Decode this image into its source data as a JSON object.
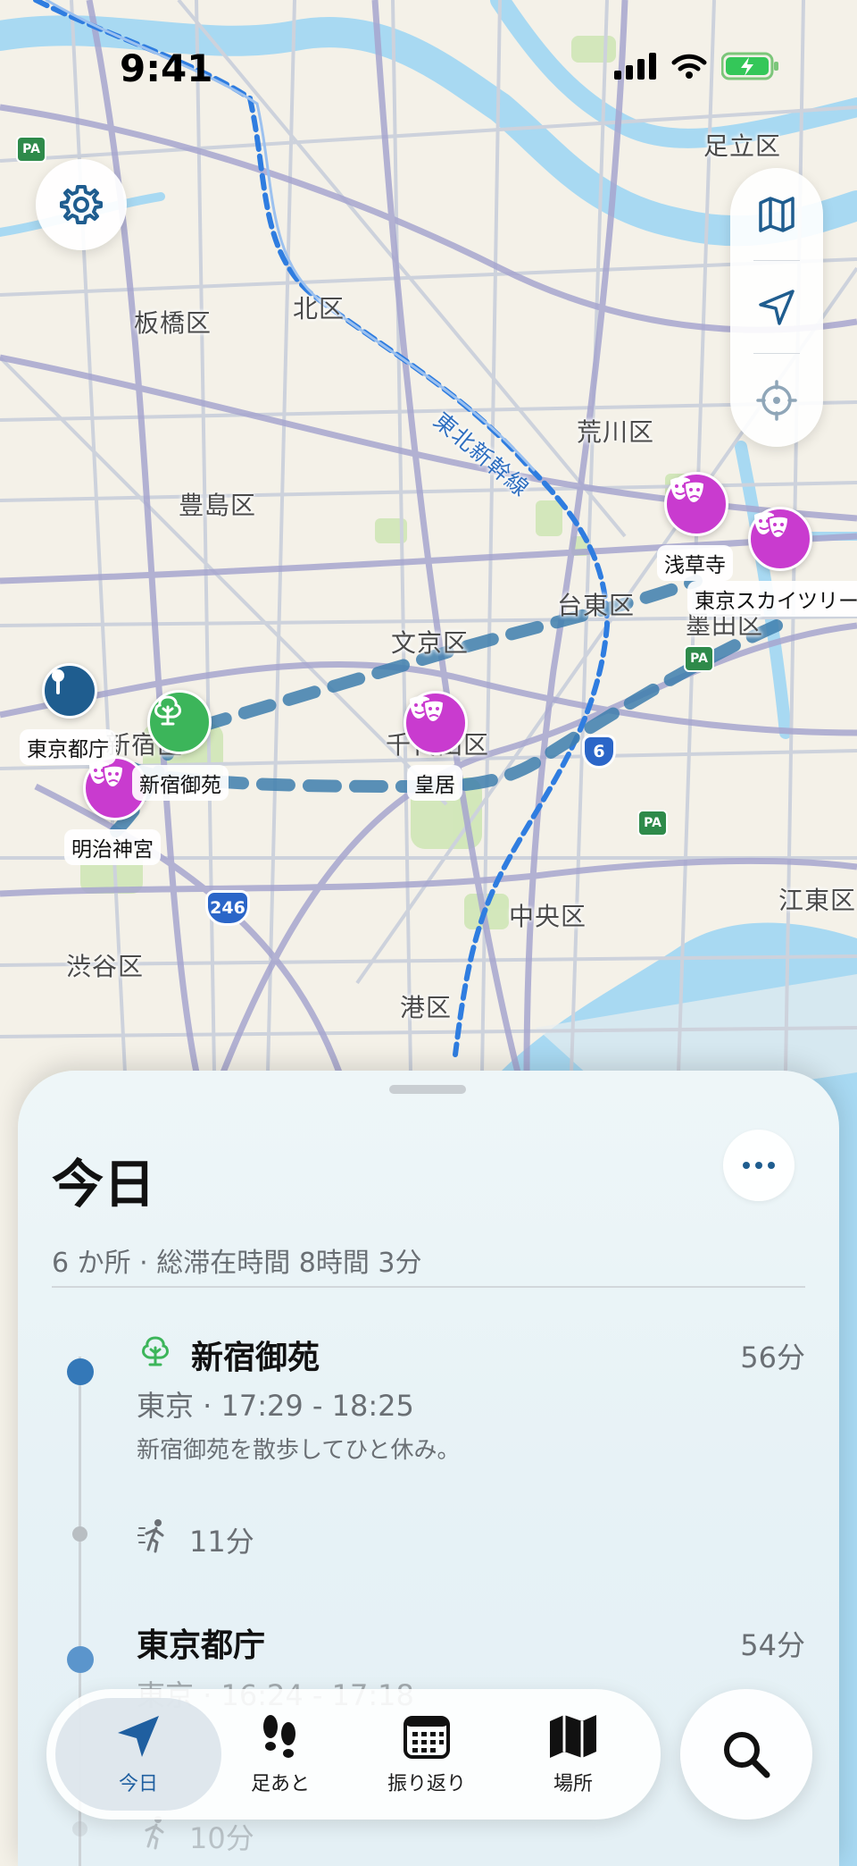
{
  "status_bar": {
    "time": "9:41"
  },
  "map": {
    "districts": [
      {
        "id": "adachi",
        "label": "足立区"
      },
      {
        "id": "itabashi",
        "label": "板橋区"
      },
      {
        "id": "kita",
        "label": "北区"
      },
      {
        "id": "arakawa",
        "label": "荒川区"
      },
      {
        "id": "toshima",
        "label": "豊島区"
      },
      {
        "id": "taito",
        "label": "台東区"
      },
      {
        "id": "bunkyo",
        "label": "文京区"
      },
      {
        "id": "sumida",
        "label": "墨田区"
      },
      {
        "id": "chiyoda",
        "label": "千代田区"
      },
      {
        "id": "shinjuku",
        "label": "新宿区"
      },
      {
        "id": "chuo",
        "label": "中央区"
      },
      {
        "id": "koto",
        "label": "江東区"
      },
      {
        "id": "shibuya",
        "label": "渋谷区"
      },
      {
        "id": "minato",
        "label": "港区"
      },
      {
        "id": "shinkansen",
        "label": "東北新幹線"
      }
    ],
    "route_shields": [
      "246",
      "6"
    ],
    "parking_label": "PA",
    "pins": [
      {
        "id": "sensoji",
        "label": "浅草寺",
        "type": "theatre-icon"
      },
      {
        "id": "skytree",
        "label": "東京スカイツリー",
        "type": "theatre-icon"
      },
      {
        "id": "kokyo",
        "label": "皇居",
        "type": "theatre-icon"
      },
      {
        "id": "meiji",
        "label": "明治神宮",
        "type": "theatre-icon"
      },
      {
        "id": "gyoen",
        "label": "新宿御苑",
        "type": "tree-icon"
      },
      {
        "id": "tocho",
        "label": "東京都庁",
        "type": "landmark-icon"
      }
    ],
    "colors": {
      "route": "#3f7fae",
      "theatre_pin": "#c93bcf",
      "park_pin": "#3cb55a",
      "landmark_pin": "#1f5d8f"
    }
  },
  "sheet": {
    "title": "今日",
    "summary": "6 か所 · 総滞在時間 8時間 3分",
    "entries": [
      {
        "name": "新宿御苑",
        "duration": "56分",
        "meta": "東京 · 17:29 - 18:25",
        "note": "新宿御苑を散歩してひと休み。",
        "icon": "tree-icon"
      },
      {
        "walk": "11分",
        "icon": "walking-icon"
      },
      {
        "name": "東京都庁",
        "duration": "54分",
        "meta": "東京 · 16:24 - 17:18"
      },
      {
        "walk": "10分",
        "icon": "walking-icon"
      }
    ]
  },
  "tabbar": {
    "tabs": [
      {
        "label": "今日",
        "icon": "location-arrow-icon",
        "active": true
      },
      {
        "label": "足あと",
        "icon": "footprints-icon"
      },
      {
        "label": "振り返り",
        "icon": "calendar-icon"
      },
      {
        "label": "場所",
        "icon": "map-icon"
      }
    ],
    "search_icon": "search-icon",
    "accent": "#1f5fa0"
  }
}
